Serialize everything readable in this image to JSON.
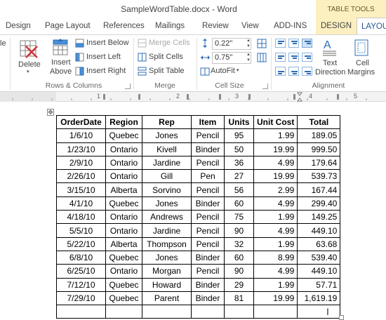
{
  "window": {
    "title": "SampleWordTable.docx - Word",
    "context_header": "TABLE TOOLS"
  },
  "tabs": [
    {
      "label": "Design"
    },
    {
      "label": "Page Layout"
    },
    {
      "label": "References"
    },
    {
      "label": "Mailings"
    },
    {
      "label": "Review"
    },
    {
      "label": "View"
    },
    {
      "label": "ADD-INS"
    },
    {
      "label": "DESIGN"
    },
    {
      "label": "LAYOUT"
    }
  ],
  "ribbon": {
    "partial_label": "le",
    "rows_columns": {
      "delete": "Delete",
      "insert_above_line1": "Insert",
      "insert_above_line2": "Above",
      "insert_below": "Insert Below",
      "insert_left": "Insert Left",
      "insert_right": "Insert Right",
      "group_label": "Rows & Columns"
    },
    "merge": {
      "merge_cells": "Merge Cells",
      "split_cells": "Split Cells",
      "split_table": "Split Table",
      "group_label": "Merge"
    },
    "cell_size": {
      "height_value": "0.22\"",
      "width_value": "0.75\"",
      "autofit": "AutoFit",
      "group_label": "Cell Size"
    },
    "alignment": {
      "text_direction_line1": "Text",
      "text_direction_line2": "Direction",
      "cell_margins_line1": "Cell",
      "cell_margins_line2": "Margins",
      "group_label": "Alignment"
    }
  },
  "ruler": {
    "marks": [
      "1",
      "2",
      "3",
      "4",
      "5"
    ]
  },
  "table": {
    "headers": [
      "OrderDate",
      "Region",
      "Rep",
      "Item",
      "Units",
      "Unit Cost",
      "Total"
    ],
    "rows": [
      [
        "1/6/10",
        "Quebec",
        "Jones",
        "Pencil",
        "95",
        "1.99",
        "189.05"
      ],
      [
        "1/23/10",
        "Ontario",
        "Kivell",
        "Binder",
        "50",
        "19.99",
        "999.50"
      ],
      [
        "2/9/10",
        "Ontario",
        "Jardine",
        "Pencil",
        "36",
        "4.99",
        "179.64"
      ],
      [
        "2/26/10",
        "Ontario",
        "Gill",
        "Pen",
        "27",
        "19.99",
        "539.73"
      ],
      [
        "3/15/10",
        "Alberta",
        "Sorvino",
        "Pencil",
        "56",
        "2.99",
        "167.44"
      ],
      [
        "4/1/10",
        "Quebec",
        "Jones",
        "Binder",
        "60",
        "4.99",
        "299.40"
      ],
      [
        "4/18/10",
        "Ontario",
        "Andrews",
        "Pencil",
        "75",
        "1.99",
        "149.25"
      ],
      [
        "5/5/10",
        "Ontario",
        "Jardine",
        "Pencil",
        "90",
        "4.99",
        "449.10"
      ],
      [
        "5/22/10",
        "Alberta",
        "Thompson",
        "Pencil",
        "32",
        "1.99",
        "63.68"
      ],
      [
        "6/8/10",
        "Quebec",
        "Jones",
        "Binder",
        "60",
        "8.99",
        "539.40"
      ],
      [
        "6/25/10",
        "Ontario",
        "Morgan",
        "Pencil",
        "90",
        "4.99",
        "449.10"
      ],
      [
        "7/12/10",
        "Quebec",
        "Howard",
        "Binder",
        "29",
        "1.99",
        "57.71"
      ],
      [
        "7/29/10",
        "Quebec",
        "Parent",
        "Binder",
        "81",
        "19.99",
        "1,619.19"
      ],
      [
        "",
        "",
        "",
        "",
        "",
        "",
        ""
      ]
    ]
  },
  "colors": {
    "context_tab_bg": "#fcefc0",
    "accent_blue": "#2b579a",
    "delete_red": "#d13438"
  }
}
